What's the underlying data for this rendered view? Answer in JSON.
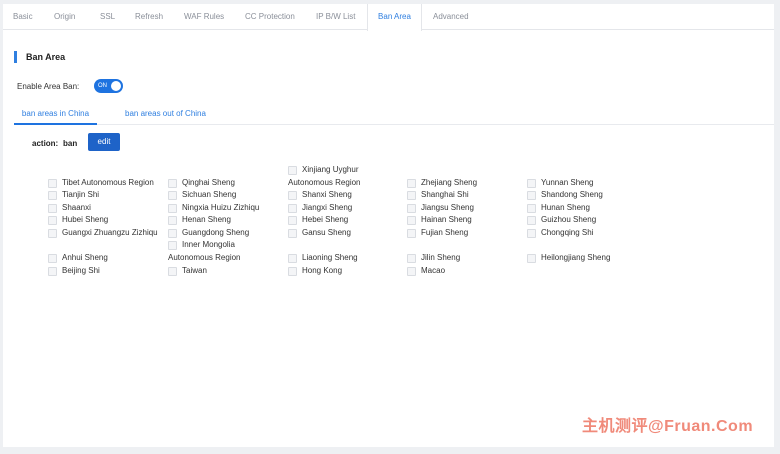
{
  "tabs": [
    "Basic",
    "Origin",
    "SSL",
    "Refresh",
    "WAF Rules",
    "CC Protection",
    "IP B/W List",
    "Ban Area",
    "Advanced"
  ],
  "active_tab": "Ban Area",
  "section_title": "Ban Area",
  "enable": {
    "label": "Enable Area Ban:",
    "toggle_text": "ON",
    "state": true
  },
  "sub_tabs": [
    "ban areas in China",
    "ban areas out of China"
  ],
  "action": {
    "label": "action:",
    "value": "ban",
    "edit_label": "edit"
  },
  "regions": [
    "Xinjiang Uyghur Autonomous Region",
    "Tibet Autonomous Region",
    "Qinghai Sheng",
    "Zhejiang Sheng",
    "Yunnan Sheng",
    "Tianjin Shi",
    "Sichuan Sheng",
    "Shanxi Sheng",
    "Shanghai Shi",
    "Shandong Sheng",
    "Shaanxi",
    "Ningxia Huizu Zizhiqu",
    "Jiangxi Sheng",
    "Jiangsu Sheng",
    "Hunan Sheng",
    "Hubei Sheng",
    "Henan Sheng",
    "Hebei Sheng",
    "Hainan Sheng",
    "Guizhou Sheng",
    "Guangxi Zhuangzu Zizhiqu",
    "Guangdong Sheng",
    "Gansu Sheng",
    "Fujian Sheng",
    "Chongqing Shi",
    "Inner Mongolia Autonomous Region",
    "Anhui Sheng",
    "Liaoning Sheng",
    "Jilin Sheng",
    "Heilongjiang Sheng",
    "Beijing Shi",
    "Taiwan",
    "Hong Kong",
    "Macao"
  ],
  "region_lines": {
    "xinjiang_1": "Xinjiang Uyghur",
    "xinjiang_2": "Autonomous Region",
    "inner_mongolia_1": "Inner Mongolia",
    "inner_mongolia_2": "Autonomous Region"
  },
  "watermark": "主机测评@Fruan.Com",
  "colors": {
    "accent": "#1e73e0",
    "tab_active": "#2f7fe0",
    "watermark": "#f08a7a"
  }
}
